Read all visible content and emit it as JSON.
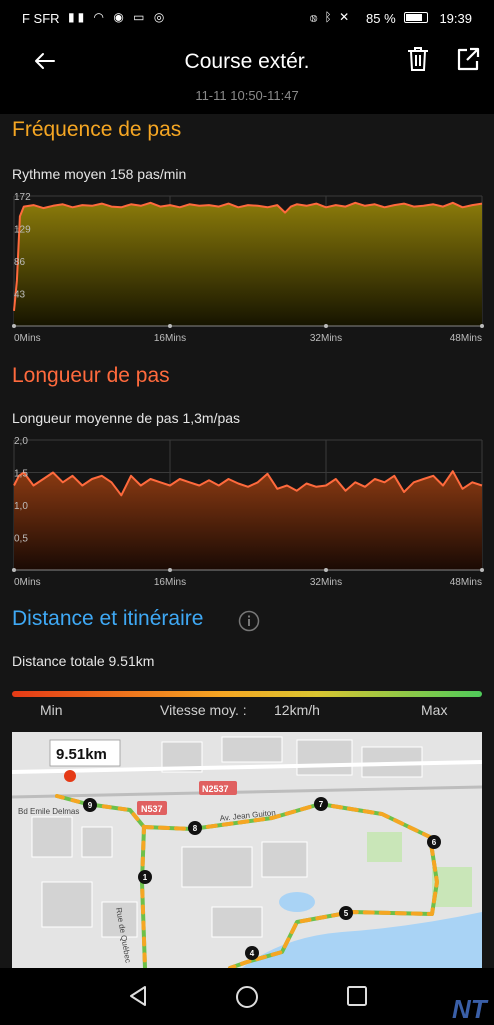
{
  "status_bar": {
    "carrier": "F SFR",
    "battery": "85 %",
    "battery_level": 0.85,
    "time": "19:39"
  },
  "header": {
    "title": "Course extér.",
    "time_range": "11-11 10:50-11:47"
  },
  "cadence": {
    "title": "Fréquence de pas",
    "summary": "Rythme moyen 158 pas/min",
    "chart_data": {
      "type": "area",
      "x_labels": [
        "0Mins",
        "16Mins",
        "32Mins",
        "48Mins"
      ],
      "y_ticks": [
        "172",
        "129",
        "86",
        "43"
      ],
      "ylim": [
        0,
        172
      ],
      "xlim": [
        0,
        48
      ],
      "grid": true,
      "x": [
        0,
        0.3,
        0.6,
        1,
        2,
        3,
        4,
        5,
        6,
        7,
        8,
        9,
        10,
        11,
        12,
        13,
        14,
        15,
        16,
        17,
        18,
        19,
        20,
        21,
        22,
        23,
        24,
        25,
        26,
        27,
        27.8,
        28.4,
        29,
        30,
        31,
        32,
        33,
        34,
        35,
        36,
        37,
        38,
        39,
        40,
        41,
        42,
        43,
        44,
        45,
        46,
        47,
        48
      ],
      "y": [
        20,
        60,
        145,
        158,
        160,
        156,
        159,
        161,
        157,
        160,
        159,
        162,
        158,
        157,
        161,
        159,
        163,
        158,
        160,
        157,
        161,
        159,
        160,
        158,
        162,
        157,
        160,
        159,
        157,
        160,
        150,
        158,
        161,
        159,
        162,
        157,
        160,
        158,
        163,
        159,
        161,
        157,
        160,
        162,
        158,
        159,
        161,
        158,
        163,
        157,
        160,
        162
      ]
    }
  },
  "stride": {
    "title": "Longueur de pas",
    "summary": "Longueur moyenne de pas 1,3m/pas",
    "chart_data": {
      "type": "area",
      "x_labels": [
        "0Mins",
        "16Mins",
        "32Mins",
        "48Mins"
      ],
      "y_ticks": [
        "2,0",
        "1,5",
        "1,0",
        "0,5"
      ],
      "ylim": [
        0,
        2.0
      ],
      "xlim": [
        0,
        48
      ],
      "grid": true,
      "x": [
        0,
        0.5,
        1,
        2,
        3,
        4,
        5,
        6,
        7,
        8,
        9,
        10,
        11,
        12,
        13,
        14,
        15,
        16,
        17,
        18,
        19,
        20,
        21,
        22,
        23,
        24,
        25,
        26,
        27,
        28,
        29,
        30,
        31,
        32,
        33,
        34,
        35,
        36,
        37,
        38,
        39,
        40,
        41,
        42,
        43,
        44,
        45,
        46,
        47,
        48
      ],
      "y": [
        1.3,
        1.45,
        1.5,
        1.3,
        1.4,
        1.5,
        1.35,
        1.45,
        1.3,
        1.4,
        1.45,
        1.35,
        1.15,
        1.45,
        1.3,
        1.4,
        1.35,
        1.3,
        1.4,
        1.35,
        1.3,
        1.38,
        1.3,
        1.4,
        1.33,
        1.28,
        1.35,
        1.48,
        1.25,
        1.3,
        1.22,
        1.33,
        1.28,
        1.3,
        1.4,
        1.22,
        1.35,
        1.28,
        1.4,
        1.35,
        1.45,
        1.2,
        1.35,
        1.4,
        1.45,
        1.3,
        1.52,
        1.25,
        1.35,
        1.3
      ]
    }
  },
  "route": {
    "title": "Distance et itinéraire",
    "info_icon": "info-icon",
    "total": "Distance totale 9.51km",
    "legend_min": "Min",
    "avg_speed_label": "Vitesse moy. :",
    "avg_speed_value": "12km/h",
    "legend_max": "Max",
    "speed_colors": [
      "#e53a16",
      "#f5a623",
      "#4fcb5a"
    ],
    "map": {
      "distance_badge": "9.51km",
      "road_labels": [
        "Bd Emile Delmas",
        "Av. Jean Guiton",
        "Rue de Québec"
      ],
      "shields": [
        "N537",
        "N2537"
      ],
      "markers": [
        "9",
        "8",
        "7",
        "6",
        "5",
        "4",
        "1"
      ]
    }
  },
  "colors": {
    "cadence_title": "#f5a623",
    "stride_title": "#ff6a3d",
    "route_title": "#3fa9f5",
    "cadence_line": "#ff6a3d",
    "stride_line": "#ff6a3d"
  },
  "icons": {
    "back": "arrow-left-icon",
    "trash": "trash-icon",
    "share": "share-icon",
    "nav": [
      "back-triangle-icon",
      "home-circle-icon",
      "recents-square-icon"
    ]
  }
}
